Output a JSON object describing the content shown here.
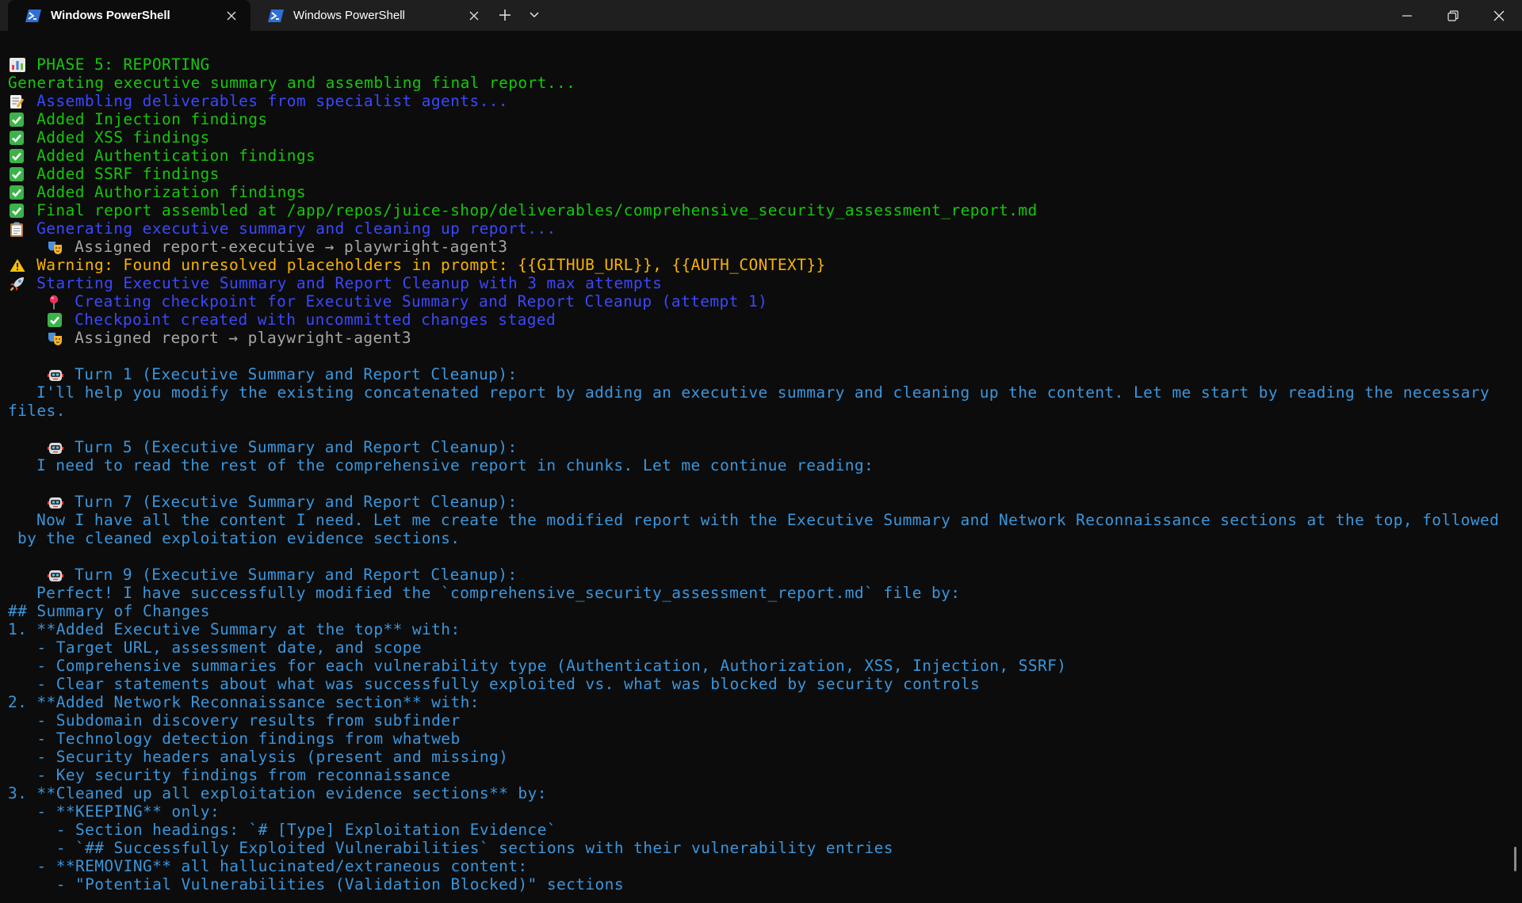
{
  "tabs": [
    {
      "title": "Windows PowerShell",
      "active": true
    },
    {
      "title": "Windows PowerShell",
      "active": false
    }
  ],
  "colors": {
    "green": "#16c60c",
    "blue": "#3b48ff",
    "gray": "#a6a6a6",
    "yellow": "#f9b200",
    "cyan": "#3a96dd",
    "background": "#0c0c0c",
    "titlebar": "#1f1f1f"
  },
  "terminal": {
    "lines": [
      {
        "icon": "bar-chart-icon",
        "text": "PHASE 5: REPORTING",
        "color": "green"
      },
      {
        "icon": "",
        "text": "Generating executive summary and assembling final report...",
        "color": "green"
      },
      {
        "icon": "memo-icon",
        "text": "Assembling deliverables from specialist agents...",
        "color": "blue"
      },
      {
        "icon": "check-mark-icon",
        "text": "Added Injection findings",
        "color": "green"
      },
      {
        "icon": "check-mark-icon",
        "text": "Added XSS findings",
        "color": "green"
      },
      {
        "icon": "check-mark-icon",
        "text": "Added Authentication findings",
        "color": "green"
      },
      {
        "icon": "check-mark-icon",
        "text": "Added SSRF findings",
        "color": "green"
      },
      {
        "icon": "check-mark-icon",
        "text": "Added Authorization findings",
        "color": "green"
      },
      {
        "icon": "check-mark-icon",
        "text": "Final report assembled at /app/repos/juice-shop/deliverables/comprehensive_security_assessment_report.md",
        "color": "green"
      },
      {
        "icon": "clipboard-icon",
        "text": "Generating executive summary and cleaning up report...",
        "color": "blue"
      },
      {
        "indent": "ind1",
        "icon": "theater-masks-icon",
        "text": "Assigned report-executive → playwright-agent3",
        "color": "gray"
      },
      {
        "icon": "warning-icon",
        "text": "Warning: Found unresolved placeholders in prompt: {{GITHUB_URL}}, {{AUTH_CONTEXT}}",
        "color": "yellow"
      },
      {
        "icon": "rocket-icon",
        "text": "Starting Executive Summary and Report Cleanup with 3 max attempts",
        "color": "blue"
      },
      {
        "indent": "ind1",
        "icon": "pushpin-icon",
        "text": "Creating checkpoint for Executive Summary and Report Cleanup (attempt 1)",
        "color": "blue"
      },
      {
        "indent": "ind1",
        "icon": "check-mark-icon",
        "text": "Checkpoint created with uncommitted changes staged",
        "color": "blue"
      },
      {
        "indent": "ind1",
        "icon": "theater-masks-icon",
        "text": "Assigned report → playwright-agent3",
        "color": "gray"
      },
      {
        "icon": "",
        "text": "",
        "color": "gray"
      },
      {
        "indent": "ind1",
        "icon": "robot-icon",
        "text": "Turn 1 (Executive Summary and Report Cleanup):",
        "color": "cyan"
      },
      {
        "indent": "ind3",
        "icon": "",
        "text": "I'll help you modify the existing concatenated report by adding an executive summary and cleaning up the content. Let me start by reading the necessary",
        "color": "cyan"
      },
      {
        "icon": "",
        "text": "files.",
        "color": "cyan"
      },
      {
        "icon": "",
        "text": "",
        "color": "gray"
      },
      {
        "indent": "ind1",
        "icon": "robot-icon",
        "text": "Turn 5 (Executive Summary and Report Cleanup):",
        "color": "cyan"
      },
      {
        "indent": "ind3",
        "icon": "",
        "text": "I need to read the rest of the comprehensive report in chunks. Let me continue reading:",
        "color": "cyan"
      },
      {
        "icon": "",
        "text": "",
        "color": "gray"
      },
      {
        "indent": "ind1",
        "icon": "robot-icon",
        "text": "Turn 7 (Executive Summary and Report Cleanup):",
        "color": "cyan"
      },
      {
        "indent": "ind3",
        "icon": "",
        "text": "Now I have all the content I need. Let me create the modified report with the Executive Summary and Network Reconnaissance sections at the top, followed",
        "color": "cyan"
      },
      {
        "indent": "ind2",
        "icon": "",
        "text": "by the cleaned exploitation evidence sections.",
        "color": "cyan"
      },
      {
        "icon": "",
        "text": "",
        "color": "gray"
      },
      {
        "indent": "ind1",
        "icon": "robot-icon",
        "text": "Turn 9 (Executive Summary and Report Cleanup):",
        "color": "cyan"
      },
      {
        "indent": "ind3",
        "icon": "",
        "text": "Perfect! I have successfully modified the `comprehensive_security_assessment_report.md` file by:",
        "color": "cyan"
      },
      {
        "icon": "",
        "text": "## Summary of Changes",
        "color": "cyan"
      },
      {
        "icon": "",
        "text": "1. **Added Executive Summary at the top** with:",
        "color": "cyan"
      },
      {
        "icon": "",
        "text": "   - Target URL, assessment date, and scope",
        "color": "cyan"
      },
      {
        "icon": "",
        "text": "   - Comprehensive summaries for each vulnerability type (Authentication, Authorization, XSS, Injection, SSRF)",
        "color": "cyan"
      },
      {
        "icon": "",
        "text": "   - Clear statements about what was successfully exploited vs. what was blocked by security controls",
        "color": "cyan"
      },
      {
        "icon": "",
        "text": "2. **Added Network Reconnaissance section** with:",
        "color": "cyan"
      },
      {
        "icon": "",
        "text": "   - Subdomain discovery results from subfinder",
        "color": "cyan"
      },
      {
        "icon": "",
        "text": "   - Technology detection findings from whatweb",
        "color": "cyan"
      },
      {
        "icon": "",
        "text": "   - Security headers analysis (present and missing)",
        "color": "cyan"
      },
      {
        "icon": "",
        "text": "   - Key security findings from reconnaissance",
        "color": "cyan"
      },
      {
        "icon": "",
        "text": "3. **Cleaned up all exploitation evidence sections** by:",
        "color": "cyan"
      },
      {
        "icon": "",
        "text": "   - **KEEPING** only:",
        "color": "cyan"
      },
      {
        "icon": "",
        "text": "     - Section headings: `# [Type] Exploitation Evidence`",
        "color": "cyan"
      },
      {
        "icon": "",
        "text": "     - `## Successfully Exploited Vulnerabilities` sections with their vulnerability entries",
        "color": "cyan"
      },
      {
        "icon": "",
        "text": "   - **REMOVING** all hallucinated/extraneous content:",
        "color": "cyan"
      },
      {
        "icon": "",
        "text": "     - \"Potential Vulnerabilities (Validation Blocked)\" sections",
        "color": "cyan"
      }
    ]
  }
}
